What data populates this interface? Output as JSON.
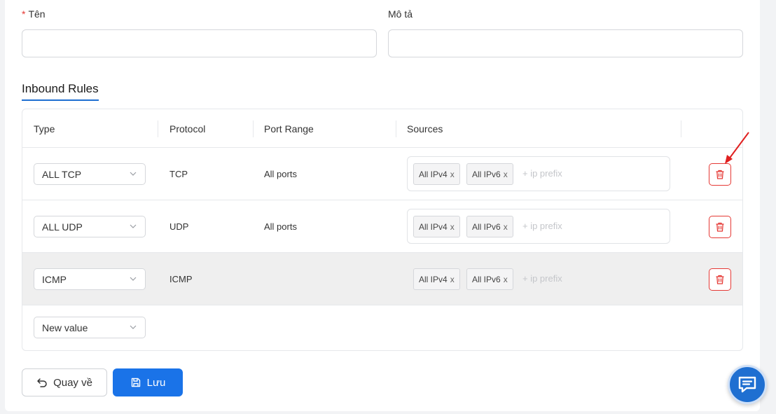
{
  "form": {
    "name_label": "Tên",
    "name_required_mark": "*",
    "name_value": "",
    "description_label": "Mô tả",
    "description_value": ""
  },
  "section": {
    "title": "Inbound Rules"
  },
  "table": {
    "headers": [
      "Type",
      "Protocol",
      "Port Range",
      "Sources"
    ],
    "rows": [
      {
        "type": "ALL TCP",
        "protocol": "TCP",
        "port_range": "All ports",
        "tags": [
          "All IPv4",
          "All IPv6"
        ],
        "placeholder": "+ ip prefix",
        "highlighted": false
      },
      {
        "type": "ALL UDP",
        "protocol": "UDP",
        "port_range": "All ports",
        "tags": [
          "All IPv4",
          "All IPv6"
        ],
        "placeholder": "+ ip prefix",
        "highlighted": false
      },
      {
        "type": "ICMP",
        "protocol": "ICMP",
        "port_range": "",
        "tags": [
          "All IPv4",
          "All IPv6"
        ],
        "placeholder": "+ ip prefix",
        "highlighted": true
      }
    ],
    "new_row_select": "New value",
    "tag_remove_glyph": "x"
  },
  "actions": {
    "back_label": "Quay về",
    "save_label": "Lưu"
  },
  "colors": {
    "accent": "#1a73e8",
    "danger": "#e53935",
    "annotation_arrow": "#e02020"
  },
  "icons": {
    "delete": "trash-icon",
    "back": "undo-arrow-icon",
    "save": "floppy-disk-icon",
    "chat": "chat-bubble-icon",
    "dropdown": "chevron-down-icon"
  }
}
